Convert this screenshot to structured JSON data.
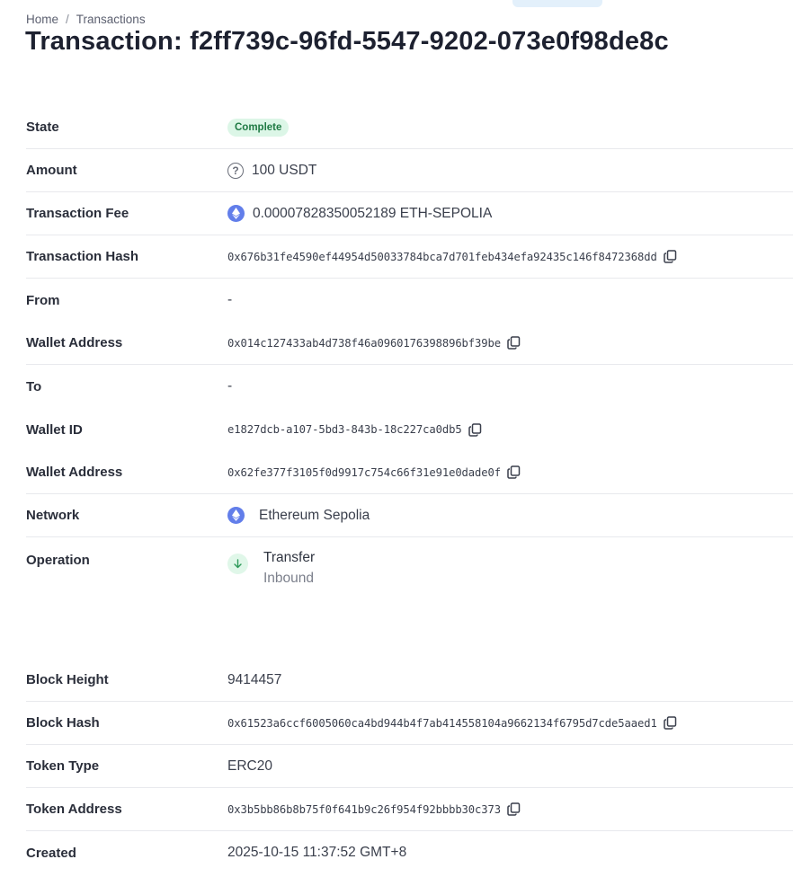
{
  "breadcrumb": {
    "home": "Home",
    "separator": "/",
    "current": "Transactions"
  },
  "page_title": "Transaction: f2ff739c-96fd-5547-9202-073e0f98de8c",
  "details": {
    "state": {
      "label": "State",
      "value": "Complete",
      "color": "#1f7a44"
    },
    "amount": {
      "label": "Amount",
      "value": "100 USDT",
      "icon": "question-icon"
    },
    "fee": {
      "label": "Transaction Fee",
      "value": "0.00007828350052189 ETH-SEPOLIA",
      "icon": "ethereum-icon"
    },
    "tx_hash": {
      "label": "Transaction Hash",
      "value": "0x676b31fe4590ef44954d50033784bca7d701feb434efa92435c146f8472368dd"
    },
    "from": {
      "label": "From",
      "value": "-"
    },
    "from_wallet_address": {
      "label": "Wallet Address",
      "value": "0x014c127433ab4d738f46a0960176398896bf39be"
    },
    "to": {
      "label": "To",
      "value": "-"
    },
    "to_wallet_id": {
      "label": "Wallet ID",
      "value": "e1827dcb-a107-5bd3-843b-18c227ca0db5"
    },
    "to_wallet_address": {
      "label": "Wallet Address",
      "value": "0x62fe377f3105f0d9917c754c66f31e91e0dade0f"
    },
    "network": {
      "label": "Network",
      "value": "Ethereum Sepolia",
      "icon": "ethereum-icon"
    },
    "operation": {
      "label": "Operation",
      "value": "Transfer",
      "direction": "Inbound",
      "icon": "arrow-down-icon"
    }
  },
  "block": {
    "height": {
      "label": "Block Height",
      "value": "9414457"
    },
    "hash": {
      "label": "Block Hash",
      "value": "0x61523a6ccf6005060ca4bd944b4f7ab414558104a9662134f6795d7cde5aaed1"
    },
    "token_type": {
      "label": "Token Type",
      "value": "ERC20"
    },
    "token_address": {
      "label": "Token Address",
      "value": "0x3b5bb86b8b75f0f641b9c26f954f92bbbb30c373"
    },
    "created": {
      "label": "Created",
      "value": "2025-10-15 11:37:52 GMT+8"
    }
  },
  "colors": {
    "accent_eth": "#627eea",
    "badge_bg": "#dcf6e7"
  }
}
